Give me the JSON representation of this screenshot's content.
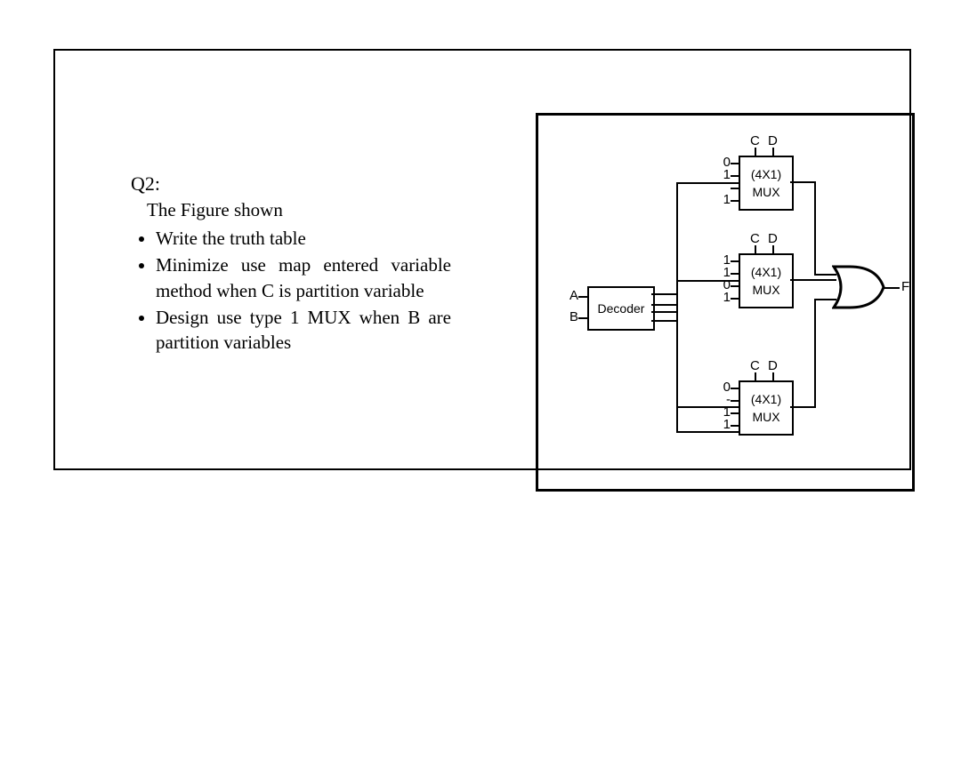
{
  "question": {
    "heading": "Q2:",
    "sub": "The Figure shown",
    "bullets": [
      "Write the truth table",
      "Minimize use map entered variable method when C is partition variable",
      "Design use type 1 MUX when B are partition variables"
    ]
  },
  "decoder": {
    "label": "Decoder",
    "inA": "A",
    "inB": "B"
  },
  "mux": {
    "type": "(4X1)",
    "name": "MUX",
    "selC": "C",
    "selD": "D"
  },
  "mux1_inputs": [
    "0",
    "1",
    "",
    "1"
  ],
  "mux2_inputs": [
    "1",
    "1",
    "0",
    "1"
  ],
  "mux3_inputs": [
    "0",
    "-",
    "1",
    "1"
  ],
  "output": "F"
}
